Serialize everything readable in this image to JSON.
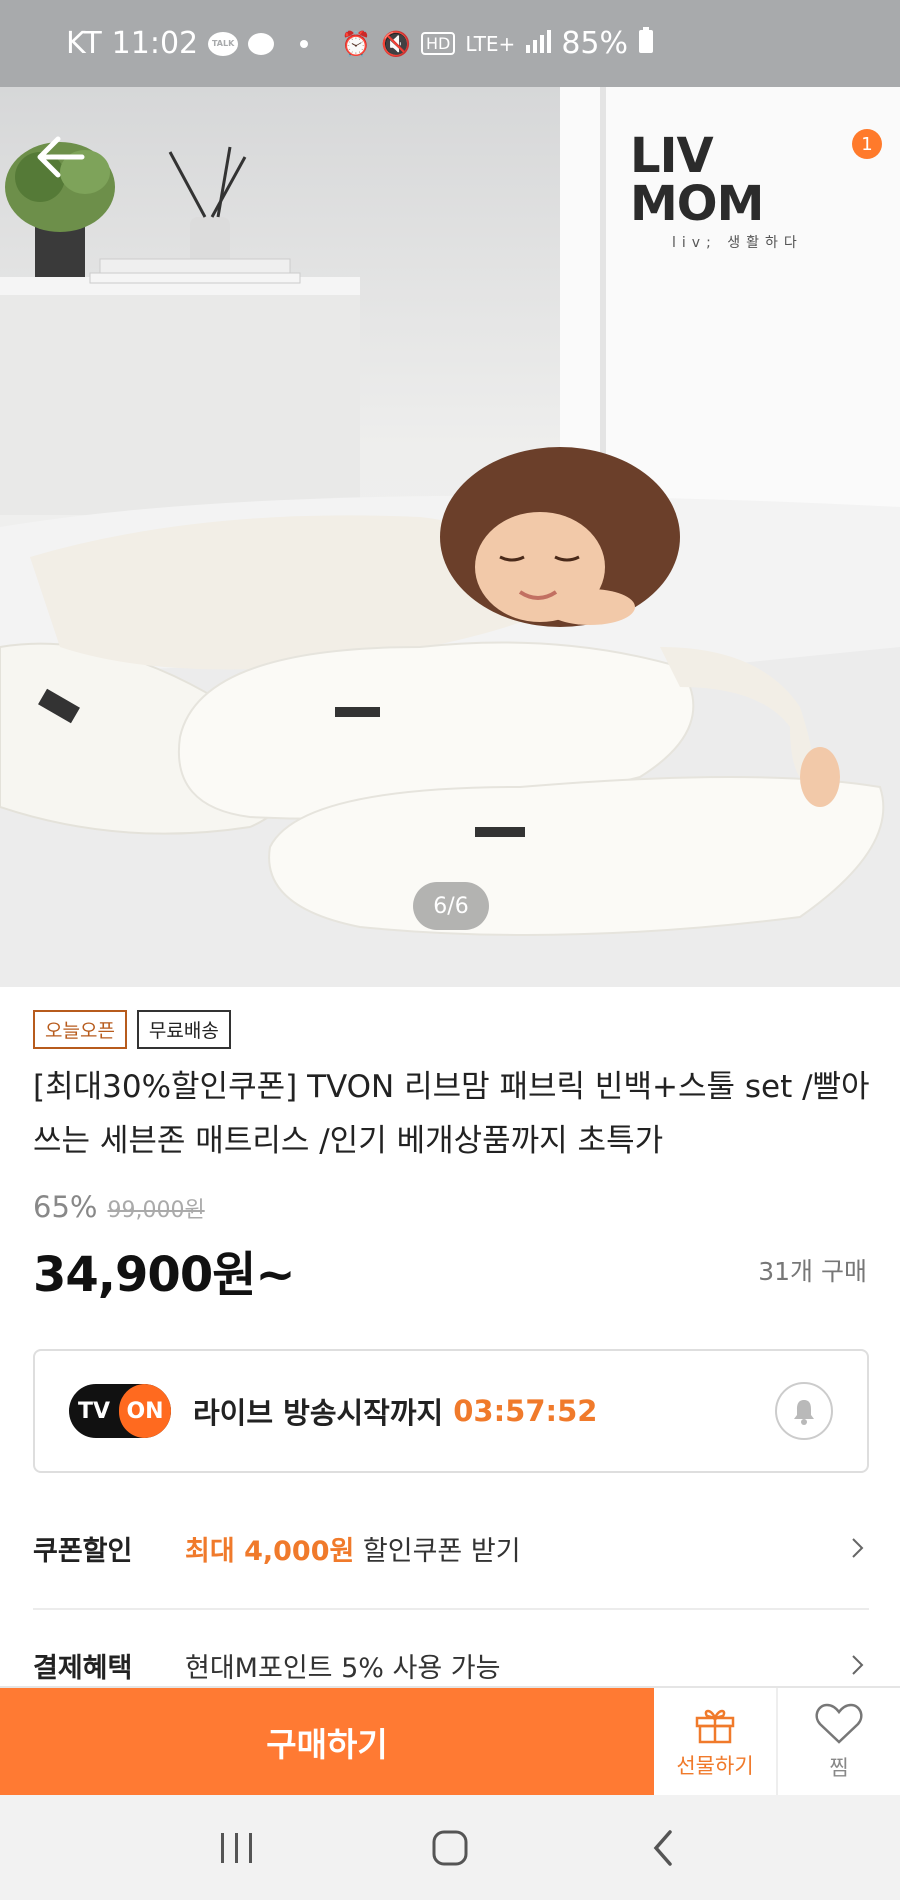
{
  "status_bar": {
    "carrier": "KT",
    "time": "11:02",
    "talk_badge": "TALK",
    "network": "LTE+",
    "hd": "HD",
    "battery": "85%"
  },
  "hero": {
    "brand_name": "LIV MOM",
    "brand_tagline": "liv; 생활하다",
    "cart_count": "1",
    "page_indicator": "6/6"
  },
  "product": {
    "badges": [
      "오늘오픈",
      "무료배송"
    ],
    "title": "[최대30%할인쿠폰] TVON 리브맘 패브릭 빈백+스툴 set /빨아쓰는 세븐존 매트리스 /인기 베개상품까지 초특가",
    "discount": "65%",
    "original_price": "99,000원",
    "price": "34,900원~",
    "purchase_count": "31개 구매"
  },
  "live": {
    "logo_tv": "TV",
    "logo_on": "ON",
    "text": "라이브 방송시작까지",
    "timer": "03:57:52"
  },
  "rows": {
    "coupon": {
      "label": "쿠폰할인",
      "highlight": "최대 4,000원",
      "value": " 할인쿠폰 받기"
    },
    "payment": {
      "label": "결제혜택",
      "value": "현대M포인트 5% 사용 가능"
    }
  },
  "actions": {
    "buy": "구매하기",
    "gift": "선물하기",
    "wish": "찜"
  },
  "colors": {
    "accent": "#ff7a33",
    "accent_text": "#f07a2b",
    "status_bar": "#a8aaac"
  }
}
